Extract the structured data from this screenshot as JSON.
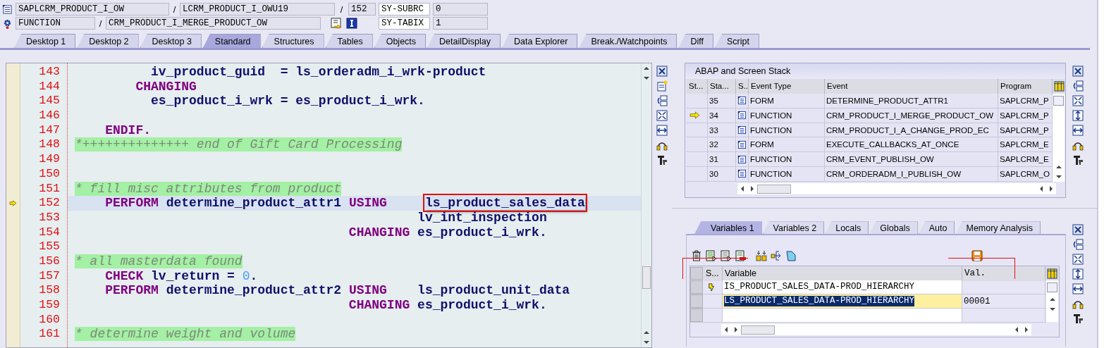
{
  "context_rows": [
    {
      "items": [
        {
          "kind": "field",
          "text": "SAPLCRM_PRODUCT_I_OW"
        },
        {
          "kind": "sep",
          "text": "/"
        },
        {
          "kind": "field",
          "text": "LCRM_PRODUCT_I_OWU19"
        },
        {
          "kind": "sep",
          "text": "/"
        },
        {
          "kind": "field",
          "text": "152"
        },
        {
          "kind": "sysfield",
          "text": "SY-SUBRC"
        },
        {
          "kind": "field",
          "text": "0"
        }
      ]
    },
    {
      "items": [
        {
          "kind": "field",
          "text": "FUNCTION"
        },
        {
          "kind": "sep",
          "text": "/"
        },
        {
          "kind": "field",
          "text": "CRM_PRODUCT_I_MERGE_PRODUCT_OW"
        },
        {
          "kind": "tools"
        },
        {
          "kind": "sysfield",
          "text": "SY-TABIX"
        },
        {
          "kind": "field",
          "text": "1"
        }
      ]
    }
  ],
  "tabs": [
    {
      "label": "Desktop 1",
      "selected": false
    },
    {
      "label": "Desktop 2",
      "selected": false
    },
    {
      "label": "Desktop 3",
      "selected": false
    },
    {
      "label": "Standard",
      "selected": true
    },
    {
      "label": "Structures",
      "selected": false
    },
    {
      "label": "Tables",
      "selected": false
    },
    {
      "label": "Objects",
      "selected": false
    },
    {
      "label": "DetailDisplay",
      "selected": false
    },
    {
      "label": "Data Explorer",
      "selected": false
    },
    {
      "label": "Break./Watchpoints",
      "selected": false
    },
    {
      "label": "Diff",
      "selected": false
    },
    {
      "label": "Script",
      "selected": false
    }
  ],
  "code": {
    "lines": [
      {
        "number": "143",
        "current": false,
        "segments": [
          {
            "kind": "var",
            "text": "          iv_product_guid  = ls_orderadm_i_wrk-product"
          }
        ]
      },
      {
        "number": "144",
        "current": false,
        "segments": [
          {
            "kind": "kw",
            "text": "        CHANGING"
          }
        ]
      },
      {
        "number": "145",
        "current": false,
        "segments": [
          {
            "kind": "var",
            "text": "          es_product_i_wrk = es_product_i_wrk."
          }
        ]
      },
      {
        "number": "146",
        "current": false
      },
      {
        "number": "147",
        "current": false,
        "segments": [
          {
            "kind": "kw",
            "text": "    ENDIF."
          }
        ]
      },
      {
        "number": "148",
        "current": false,
        "segments": [
          {
            "kind": "cmt",
            "text": "*++++++++++++++ end of Gift Card Processing"
          }
        ]
      },
      {
        "number": "149",
        "current": false
      },
      {
        "number": "150",
        "current": false
      },
      {
        "number": "151",
        "current": false,
        "segments": [
          {
            "kind": "cmt",
            "text": "* fill misc attributes from product"
          }
        ]
      },
      {
        "number": "152",
        "current": true,
        "segments": [
          {
            "kind": "kw",
            "text": "    PERFORM "
          },
          {
            "kind": "var",
            "text": "determine_product_attr1 "
          },
          {
            "kind": "kw",
            "text": "USING     "
          },
          {
            "kind": "var",
            "text": "ls_product_sales_data",
            "boxed": true
          }
        ]
      },
      {
        "number": "153",
        "current": false,
        "segments": [
          {
            "kind": "var",
            "text": "                                             lv_int_inspection"
          }
        ]
      },
      {
        "number": "154",
        "current": false,
        "segments": [
          {
            "kind": "kw",
            "text": "                                    CHANGING "
          },
          {
            "kind": "var",
            "text": "es_product_i_wrk."
          }
        ]
      },
      {
        "number": "155",
        "current": false
      },
      {
        "number": "156",
        "current": false,
        "segments": [
          {
            "kind": "cmt",
            "text": "* all masterdata found"
          }
        ]
      },
      {
        "number": "157",
        "current": false,
        "segments": [
          {
            "kind": "kw",
            "text": "    CHECK "
          },
          {
            "kind": "var",
            "text": "lv_return = "
          },
          {
            "kind": "num",
            "text": "0"
          },
          {
            "kind": "var",
            "text": "."
          }
        ]
      },
      {
        "number": "158",
        "current": false,
        "segments": [
          {
            "kind": "kw",
            "text": "    PERFORM "
          },
          {
            "kind": "var",
            "text": "determine_product_attr2 "
          },
          {
            "kind": "kw",
            "text": "USING    "
          },
          {
            "kind": "var",
            "text": "ls_product_unit_data"
          }
        ]
      },
      {
        "number": "159",
        "current": false,
        "segments": [
          {
            "kind": "kw",
            "text": "                                    CHANGING "
          },
          {
            "kind": "var",
            "text": "es_product_i_wrk."
          }
        ]
      },
      {
        "number": "160",
        "current": false
      },
      {
        "number": "161",
        "current": false,
        "segments": [
          {
            "kind": "cmt",
            "text": "* determine weight and volume"
          }
        ]
      }
    ]
  },
  "stack": {
    "title": "ABAP and Screen Stack",
    "columns": [
      "St...",
      "Sta...",
      "S..",
      "Event Type",
      "Event",
      "Program"
    ],
    "rows": [
      {
        "current": false,
        "level": "35",
        "type": "FORM",
        "event": "DETERMINE_PRODUCT_ATTR1",
        "program": "SAPLCRM_P"
      },
      {
        "current": true,
        "level": "34",
        "type": "FUNCTION",
        "event": "CRM_PRODUCT_I_MERGE_PRODUCT_OW",
        "program": "SAPLCRM_P"
      },
      {
        "current": false,
        "level": "33",
        "type": "FUNCTION",
        "event": "CRM_PRODUCT_I_A_CHANGE_PROD_EC",
        "program": "SAPLCRM_P"
      },
      {
        "current": false,
        "level": "32",
        "type": "FORM",
        "event": "EXECUTE_CALLBACKS_AT_ONCE",
        "program": "SAPLCRM_E"
      },
      {
        "current": false,
        "level": "31",
        "type": "FUNCTION",
        "event": "CRM_EVENT_PUBLISH_OW",
        "program": "SAPLCRM_E"
      },
      {
        "current": false,
        "level": "30",
        "type": "FUNCTION",
        "event": "CRM_ORDERADM_I_PUBLISH_OW",
        "program": "SAPLCRM_O"
      }
    ]
  },
  "variables": {
    "tabs": [
      {
        "label": "Variables 1",
        "selected": true
      },
      {
        "label": "Variables 2",
        "selected": false
      },
      {
        "label": "Locals",
        "selected": false
      },
      {
        "label": "Globals",
        "selected": false
      },
      {
        "label": "Auto",
        "selected": false
      },
      {
        "label": "Memory Analysis",
        "selected": false
      }
    ],
    "columns": [
      "S...",
      "Variable",
      "Val."
    ],
    "rows": [
      {
        "changed": true,
        "selected": false,
        "variable": "IS_PRODUCT_SALES_DATA-PROD_HIERARCHY"
      },
      {
        "changed": false,
        "selected": true,
        "variable": "LS_PRODUCT_SALES_DATA-PROD_HIERARCHY",
        "value": "00001"
      }
    ]
  }
}
